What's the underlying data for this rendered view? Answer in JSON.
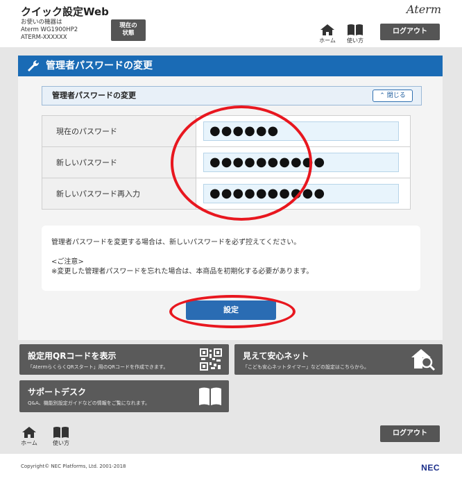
{
  "header": {
    "app_title": "クイック設定Web",
    "device_label": "お使いの機器は",
    "device_model": "Aterm WG1900HP2",
    "device_id": "ATERM-XXXXXX",
    "status_button_line1": "現在の",
    "status_button_line2": "状態",
    "brand": "Aterm",
    "home_label": "ホーム",
    "manual_label": "使い方",
    "logout_label": "ログアウト"
  },
  "section": {
    "title": "管理者パスワードの変更",
    "sub_title": "管理者パスワードの変更",
    "close_label": "閉じる"
  },
  "form": {
    "rows": [
      {
        "label": "現在のパスワード",
        "value": "●●●●●●"
      },
      {
        "label": "新しいパスワード",
        "value": "●●●●●●●●●●"
      },
      {
        "label": "新しいパスワード再入力",
        "value": "●●●●●●●●●●"
      }
    ]
  },
  "notice": {
    "line1": "管理者パスワードを変更する場合は、新しいパスワードを必ず控えてください。",
    "caution_heading": "<ご注意>",
    "caution_text": "※変更した管理者パスワードを忘れた場合は、本商品を初期化する必要があります。"
  },
  "actions": {
    "setting_label": "設定"
  },
  "tiles": {
    "qr": {
      "title": "設定用QRコードを表示",
      "desc": "「AtermらくらくQRスタート」用のQRコードを作成できます。"
    },
    "safety": {
      "title": "見えて安心ネット",
      "desc": "「こども安心ネットタイマー」などの設定はこちらから。"
    },
    "support": {
      "title": "サポートデスク",
      "desc": "Q&A、機能別設定ガイドなどの情報をご覧になれます。"
    }
  },
  "footer": {
    "home_label": "ホーム",
    "manual_label": "使い方",
    "logout_label": "ログアウト",
    "copyright": "Copyright© NEC Platforms, Ltd. 2001-2018",
    "nec": "NEC"
  },
  "colors": {
    "accent_blue": "#1a6bb5",
    "annotation_red": "#e8171f",
    "tile_gray": "#5a5a5a"
  }
}
